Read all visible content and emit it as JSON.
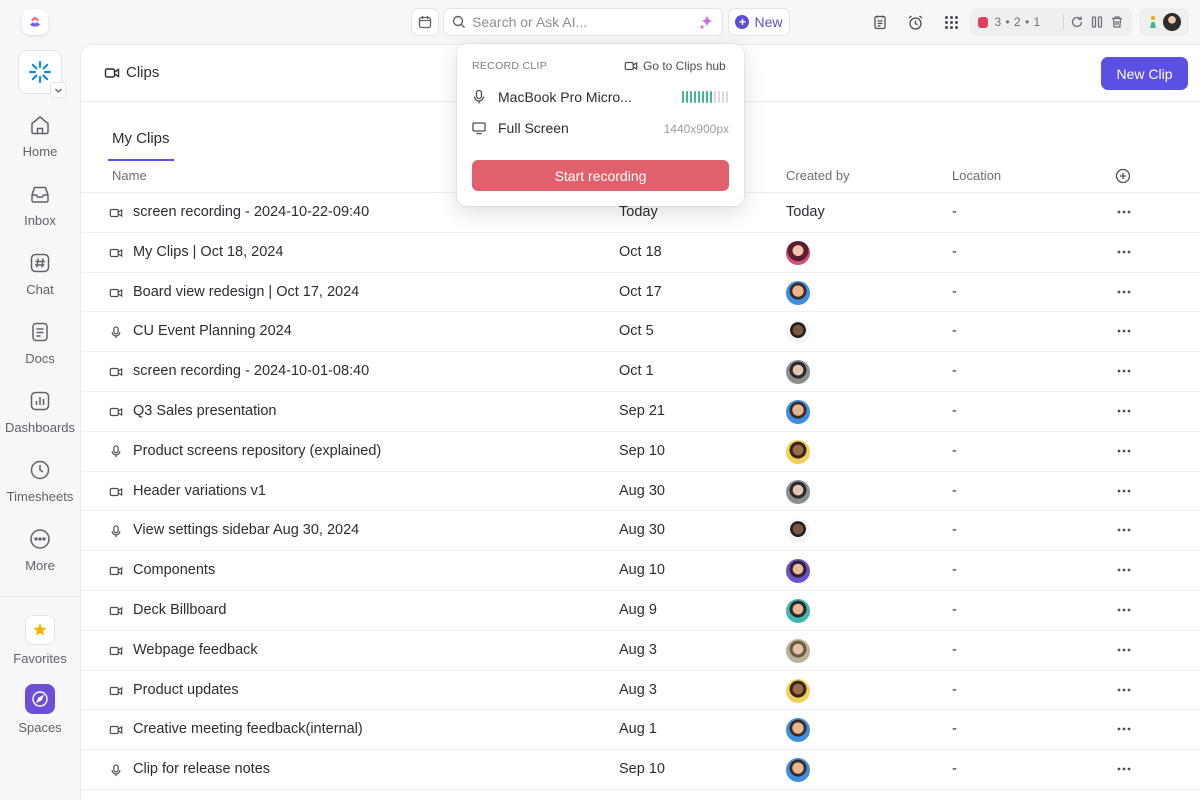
{
  "topbar": {
    "search_placeholder": "Search or Ask AI...",
    "new_label": "New",
    "record_counter": "3 • 2 • 1"
  },
  "sidebar": {
    "items": [
      {
        "label": "Home",
        "icon": "home-icon"
      },
      {
        "label": "Inbox",
        "icon": "inbox-icon"
      },
      {
        "label": "Chat",
        "icon": "hash-icon"
      },
      {
        "label": "Docs",
        "icon": "doc-icon"
      },
      {
        "label": "Dashboards",
        "icon": "dashboard-icon"
      },
      {
        "label": "Timesheets",
        "icon": "clock-icon"
      },
      {
        "label": "More",
        "icon": "more-icon"
      }
    ],
    "favorites_label": "Favorites",
    "spaces_label": "Spaces"
  },
  "main": {
    "page_title": "Clips",
    "new_clip_label": "New Clip",
    "tab_label": "My Clips",
    "columns": {
      "name": "Name",
      "created_by": "Created by",
      "location": "Location"
    }
  },
  "rows": [
    {
      "type": "video",
      "name": "screen recording - 2024-10-22-09:40",
      "date": "Today",
      "creator_text": "Today",
      "location": "-"
    },
    {
      "type": "video",
      "name": "My Clips | Oct 18, 2024",
      "date": "Oct 18",
      "avatar": "pink",
      "location": "-"
    },
    {
      "type": "video",
      "name": "Board view redesign | Oct 17, 2024",
      "date": "Oct 17",
      "avatar": "blue",
      "location": "-"
    },
    {
      "type": "audio",
      "name": "CU Event Planning 2024",
      "date": "Oct 5",
      "avatar": "white",
      "location": "-"
    },
    {
      "type": "video",
      "name": "screen recording - 2024-10-01-08:40",
      "date": "Oct 1",
      "avatar": "gray",
      "location": "-"
    },
    {
      "type": "video",
      "name": "Q3 Sales presentation",
      "date": "Sep 21",
      "avatar": "blue",
      "location": "-"
    },
    {
      "type": "audio",
      "name": "Product screens repository (explained)",
      "date": "Sep 10",
      "avatar": "yellow",
      "location": "-"
    },
    {
      "type": "video",
      "name": "Header variations v1",
      "date": "Aug 30",
      "avatar": "gray",
      "location": "-"
    },
    {
      "type": "audio",
      "name": "View settings sidebar Aug 30, 2024",
      "date": "Aug 30",
      "avatar": "white",
      "location": "-"
    },
    {
      "type": "video",
      "name": "Components",
      "date": "Aug 10",
      "avatar": "purple",
      "location": "-"
    },
    {
      "type": "video",
      "name": "Deck Billboard",
      "date": "Aug 9",
      "avatar": "teal",
      "location": "-"
    },
    {
      "type": "video",
      "name": "Webpage feedback",
      "date": "Aug 3",
      "avatar": "olive",
      "location": "-"
    },
    {
      "type": "video",
      "name": "Product updates",
      "date": "Aug 3",
      "avatar": "yellow",
      "location": "-"
    },
    {
      "type": "video",
      "name": "Creative  meeting feedback(internal)",
      "date": "Aug 1",
      "avatar": "blue",
      "location": "-"
    },
    {
      "type": "audio",
      "name": "Clip for release notes",
      "date": "Sep 10",
      "avatar": "blue",
      "location": "-"
    }
  ],
  "popover": {
    "title": "RECORD CLIP",
    "hub_label": "Go to Clips hub",
    "mic_label": "MacBook Pro Micro...",
    "mic_level": 0.7,
    "screen_label": "Full Screen",
    "resolution": "1440x900px",
    "start_label": "Start recording"
  },
  "colors": {
    "accent": "#5b4fe4",
    "record_red": "#e0616b",
    "level_green": "#3db892"
  }
}
